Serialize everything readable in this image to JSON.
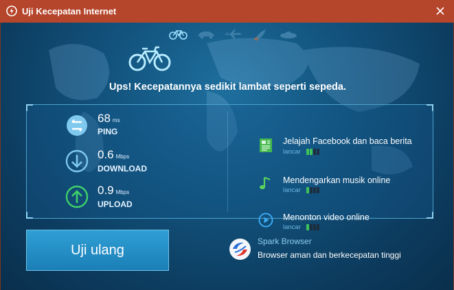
{
  "window": {
    "title": "Uji Kecepatan Internet"
  },
  "modes": [
    {
      "name": "bicycle",
      "icon": "bicycle-icon"
    },
    {
      "name": "car",
      "icon": "car-icon"
    },
    {
      "name": "plane",
      "icon": "plane-icon"
    },
    {
      "name": "rocket",
      "icon": "rocket-icon"
    },
    {
      "name": "ufo",
      "icon": "ufo-icon"
    }
  ],
  "headline": "Ups! Kecepatannya sedikit lambat seperti sepeda.",
  "metrics": {
    "ping": {
      "value": "68",
      "unit": "ms",
      "label": "PING"
    },
    "download": {
      "value": "0.6",
      "unit": "Mbps",
      "label": "DOWNLOAD"
    },
    "upload": {
      "value": "0.9",
      "unit": "Mbps",
      "label": "UPLOAD"
    }
  },
  "activities": [
    {
      "title": "Jelajah Facebook dan baca berita",
      "status": "lancar",
      "level": 2,
      "max": 4
    },
    {
      "title": "Mendengarkan musik online",
      "status": "lancar",
      "level": 1,
      "max": 4
    },
    {
      "title": "Menonton video online",
      "status": "lancar",
      "level": 1,
      "max": 4
    }
  ],
  "retest_label": "Uji ulang",
  "promo": {
    "name": "Spark Browser",
    "description": "Browser aman dan berkecepatan tinggi"
  },
  "colors": {
    "titlebar": "#b5452b",
    "panel_border": "#4ca3cf",
    "accent_green": "#3fc25a",
    "button": "#2f9fd4"
  }
}
